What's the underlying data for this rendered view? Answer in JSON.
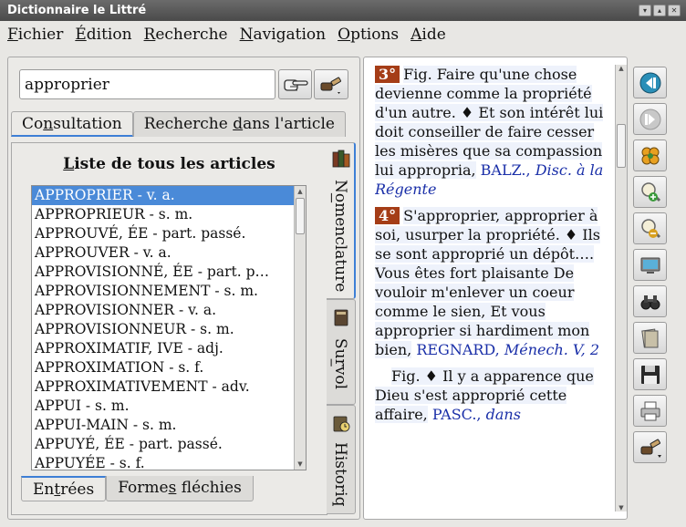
{
  "window": {
    "title": "Dictionnaire le Littré"
  },
  "menu": [
    {
      "u": "F",
      "rest": "ichier"
    },
    {
      "u": "É",
      "rest": "dition"
    },
    {
      "u": "R",
      "rest": "echerche"
    },
    {
      "u": "N",
      "rest": "avigation"
    },
    {
      "u": "O",
      "rest": "ptions"
    },
    {
      "u": "A",
      "rest": "ide"
    }
  ],
  "search": {
    "value": "approprier"
  },
  "top_tabs": {
    "consultation_pre": "Co",
    "consultation_u": "n",
    "consultation_post": "sultation",
    "recherche_pre": "Recherche ",
    "recherche_u": "d",
    "recherche_post": "ans l'article"
  },
  "list": {
    "title_u": "L",
    "title_rest": "iste de tous les articles",
    "items": [
      "APPROPRIER - v. a.",
      "APPROPRIEUR - s. m.",
      "APPROUVÉ, ÉE - part. passé.",
      "APPROUVER - v. a.",
      "APPROVISIONNÉ, ÉE - part. p…",
      "APPROVISIONNEMENT - s. m.",
      "APPROVISIONNER - v. a.",
      "APPROVISIONNEUR - s. m.",
      "APPROXIMATIF, IVE - adj.",
      "APPROXIMATION - s. f.",
      "APPROXIMATIVEMENT - adv.",
      "APPUI - s. m.",
      "APPUI-MAIN - s. m.",
      "APPUYÉ, ÉE - part. passé.",
      "APPUYÉE - s. f."
    ]
  },
  "bottom_tabs": {
    "entrees_pre": "En",
    "entrees_u": "t",
    "entrees_post": "rées",
    "formes_pre": "Forme",
    "formes_u": "s",
    "formes_post": " fléchies"
  },
  "side_tabs": {
    "nomenclature_pre": "N",
    "nomenclature_u": "o",
    "nomenclature_post": "menclature",
    "survol_pre": "Su",
    "survol_u": "r",
    "survol_post": "vol",
    "historique": "Historiq"
  },
  "article": {
    "p1": {
      "num": "3°",
      "text": "Fig. Faire qu'une chose devienne comme la propriété d'un autre. ♦ Et son intérêt lui doit conseiller de faire cesser les misères que sa compassion lui appropria,",
      "author": "BALZ.,",
      "work": "Disc. à la Régente"
    },
    "p2": {
      "num": "4°",
      "text": "S'approprier, approprier à soi, usurper la propriété. ♦ Ils se sont approprié un dépôt…. Vous êtes fort plaisante De vouloir m'enlever un coeur comme le sien, Et vous approprier si hardiment mon bien,",
      "author": "REGNARD,",
      "work": "Ménech. V, 2"
    },
    "p3": {
      "text": "Fig. ♦ Il y a apparence que Dieu s'est approprié cette affaire,",
      "author": "PASC.,",
      "work": "dans"
    }
  },
  "colors": {
    "accent": "#3d7fd6",
    "number_bg": "#a53d17",
    "reference": "#1a2fa8",
    "selection": "#4a8ad8"
  }
}
